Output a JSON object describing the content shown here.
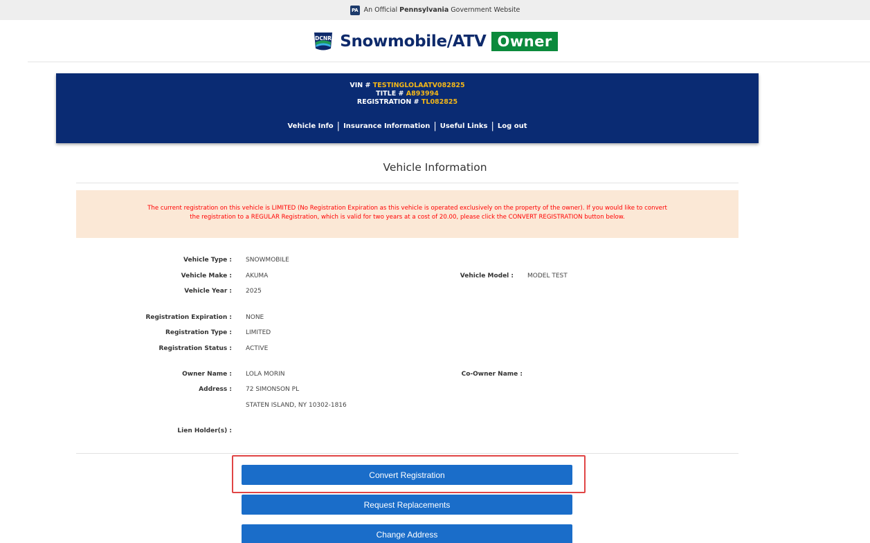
{
  "gov_banner": {
    "badge": "PA",
    "prefix": "An Official",
    "state": "Pennsylvania",
    "suffix": "Government Website"
  },
  "logo": {
    "badge_text": "DCNR",
    "title": "Snowmobile/ATV",
    "owner": "Owner",
    "brand_color": "#0b8a3c"
  },
  "info_panel": {
    "vin_label": "VIN #",
    "vin": "TESTINGLOLAATV082825",
    "title_label": "TITLE #",
    "title": "A893994",
    "registration_label": "REGISTRATION #",
    "registration": "TL082825",
    "nav": [
      "Vehicle Info",
      "Insurance Information",
      "Useful Links",
      "Log out"
    ]
  },
  "section_title": "Vehicle Information",
  "notice": {
    "line1": "The current registration on this vehicle is LIMITED (No Registration Expiration as this vehicle is operated exclusively on the property of the owner). If you would like to convert",
    "line2": "the registration to a REGULAR Registration, which is valid for two years at a cost of 20.00, please click the CONVERT REGISTRATION button below."
  },
  "details": {
    "vehicle_type_label": "Vehicle Type :",
    "vehicle_type": "SNOWMOBILE",
    "vehicle_make_label": "Vehicle Make :",
    "vehicle_make": "AKUMA",
    "vehicle_model_label": "Vehicle Model :",
    "vehicle_model": "MODEL TEST",
    "vehicle_year_label": "Vehicle Year :",
    "vehicle_year": "2025",
    "reg_expiration_label": "Registration Expiration :",
    "reg_expiration": "NONE",
    "reg_type_label": "Registration Type :",
    "reg_type": "LIMITED",
    "reg_status_label": "Registration Status :",
    "reg_status": "ACTIVE",
    "owner_name_label": "Owner Name :",
    "owner_name": "LOLA MORIN",
    "co_owner_label": "Co-Owner Name :",
    "address_label": "Address :",
    "address_line1": "72 SIMONSON PL",
    "address_line2": "STATEN ISLAND, NY 10302-1816",
    "lien_label": "Lien Holder(s) :"
  },
  "buttons": {
    "convert": "Convert Registration",
    "replacements": "Request Replacements",
    "change_address": "Change Address"
  }
}
